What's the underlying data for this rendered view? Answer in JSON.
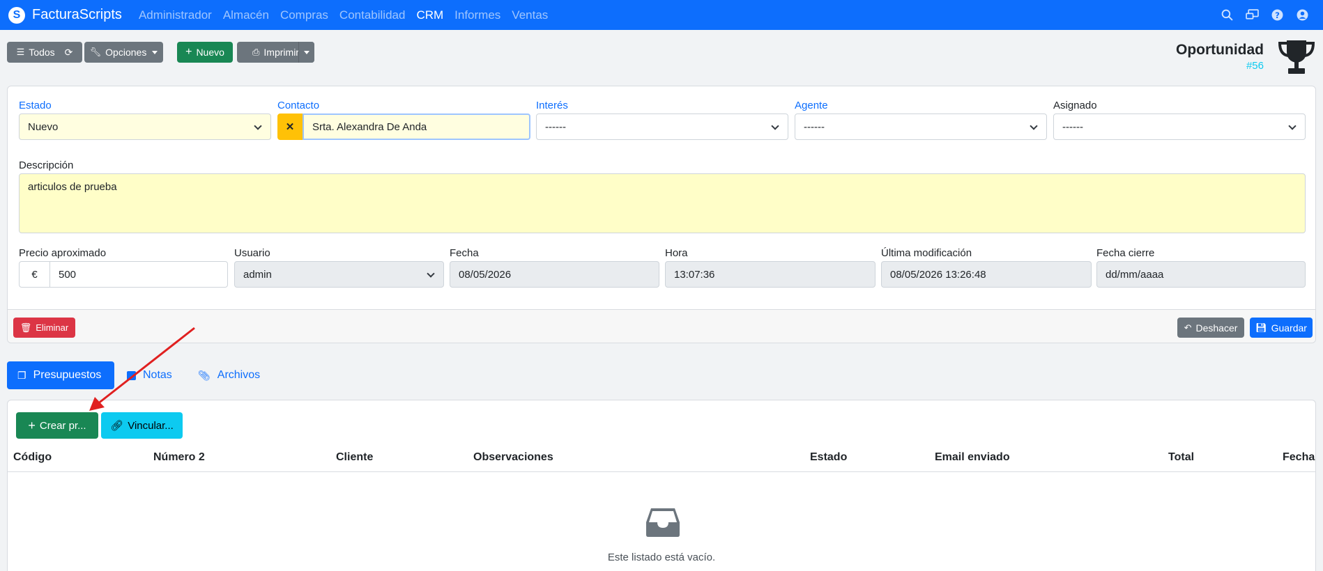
{
  "navbar": {
    "brand": "FacturaScripts",
    "menu": [
      "Administrador",
      "Almacén",
      "Compras",
      "Contabilidad",
      "CRM",
      "Informes",
      "Ventas"
    ],
    "active_menu": "CRM",
    "icons": [
      "search-icon",
      "chat-icon",
      "help-icon",
      "user-icon"
    ]
  },
  "toolbar": {
    "todos": "Todos",
    "opciones": "Opciones",
    "nuevo": "Nuevo",
    "imprimir": "Imprimir"
  },
  "header": {
    "title": "Oportunidad",
    "subtitle": "#56"
  },
  "form": {
    "estado": {
      "label": "Estado",
      "value": "Nuevo"
    },
    "contacto": {
      "label": "Contacto",
      "value": "Srta. Alexandra De Anda"
    },
    "interes": {
      "label": "Interés",
      "value": "------"
    },
    "agente": {
      "label": "Agente",
      "value": "------"
    },
    "asignado": {
      "label": "Asignado",
      "value": "------"
    },
    "descripcion": {
      "label": "Descripción",
      "value": "articulos de prueba"
    },
    "precio": {
      "label": "Precio aproximado",
      "currency": "€",
      "value": "500"
    },
    "usuario": {
      "label": "Usuario",
      "value": "admin"
    },
    "fecha": {
      "label": "Fecha",
      "value": "08/05/2026"
    },
    "hora": {
      "label": "Hora",
      "value": "13:07:36"
    },
    "ultima": {
      "label": "Última modificación",
      "value": "08/05/2026 13:26:48"
    },
    "cierre": {
      "label": "Fecha cierre",
      "placeholder": "dd/mm/aaaa"
    }
  },
  "form_actions": {
    "eliminar": "Eliminar",
    "deshacer": "Deshacer",
    "guardar": "Guardar"
  },
  "tabs": [
    {
      "label": "Presupuestos",
      "active": true
    },
    {
      "label": "Notas",
      "active": false
    },
    {
      "label": "Archivos",
      "active": false
    }
  ],
  "list": {
    "crear": "Crear pr...",
    "vincular": "Vincular...",
    "columns": [
      "Código",
      "Número 2",
      "Cliente",
      "Observaciones",
      "Estado",
      "Email enviado",
      "Total",
      "Fecha"
    ],
    "empty": "Este listado está vacío."
  },
  "colors": {
    "primary": "#0d6efd",
    "success": "#198754",
    "danger": "#dc3545",
    "secondary": "#6c757d",
    "info": "#0dcaf0",
    "warning": "#ffc107"
  }
}
